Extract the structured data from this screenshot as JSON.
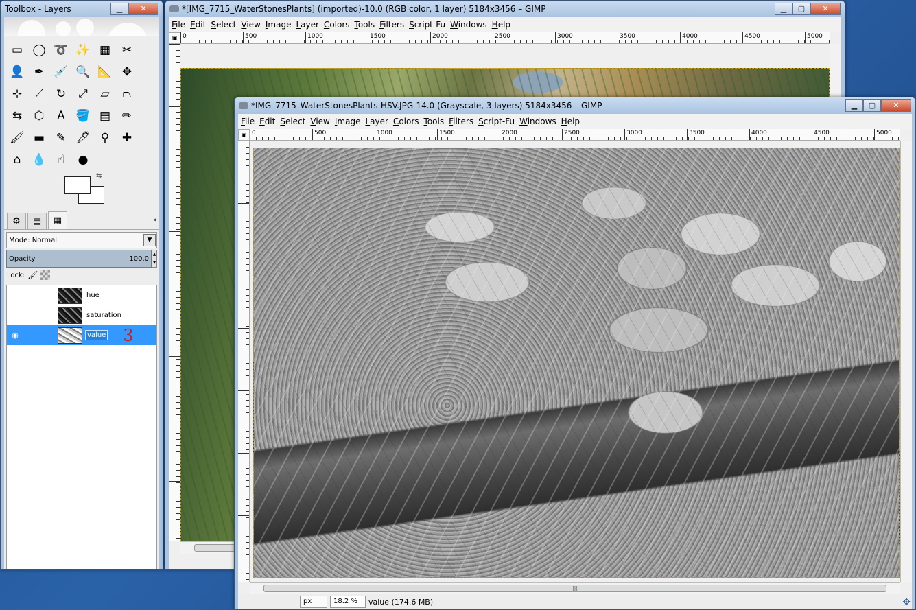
{
  "toolbox": {
    "title": "Toolbox - Layers",
    "controls": {
      "minimize": "▁",
      "close": "✕"
    },
    "tools": [
      {
        "name": "rect-select-icon",
        "glyph": "▭"
      },
      {
        "name": "ellipse-select-icon",
        "glyph": "◯"
      },
      {
        "name": "free-select-icon",
        "glyph": "➰"
      },
      {
        "name": "fuzzy-select-icon",
        "glyph": "✨"
      },
      {
        "name": "select-by-color-icon",
        "glyph": "▦"
      },
      {
        "name": "scissors-select-icon",
        "glyph": "✂"
      },
      {
        "name": "foreground-select-icon",
        "glyph": "👤"
      },
      {
        "name": "paths-icon",
        "glyph": "✒"
      },
      {
        "name": "color-picker-icon",
        "glyph": "💉"
      },
      {
        "name": "zoom-icon",
        "glyph": "🔍"
      },
      {
        "name": "measure-icon",
        "glyph": "📐"
      },
      {
        "name": "move-icon",
        "glyph": "✥"
      },
      {
        "name": "align-icon",
        "glyph": "⊹"
      },
      {
        "name": "crop-icon",
        "glyph": "⟋"
      },
      {
        "name": "rotate-icon",
        "glyph": "↻"
      },
      {
        "name": "scale-icon",
        "glyph": "⤢"
      },
      {
        "name": "shear-icon",
        "glyph": "▱"
      },
      {
        "name": "perspective-icon",
        "glyph": "⏢"
      },
      {
        "name": "flip-icon",
        "glyph": "⇆"
      },
      {
        "name": "cage-transform-icon",
        "glyph": "⬡"
      },
      {
        "name": "text-icon",
        "glyph": "A"
      },
      {
        "name": "bucket-fill-icon",
        "glyph": "🪣"
      },
      {
        "name": "blend-icon",
        "glyph": "▤"
      },
      {
        "name": "pencil-icon",
        "glyph": "✏"
      },
      {
        "name": "paintbrush-icon",
        "glyph": "🖌"
      },
      {
        "name": "eraser-icon",
        "glyph": "▬"
      },
      {
        "name": "airbrush-icon",
        "glyph": "✎"
      },
      {
        "name": "ink-icon",
        "glyph": "🖋"
      },
      {
        "name": "clone-icon",
        "glyph": "⚲"
      },
      {
        "name": "heal-icon",
        "glyph": "✚"
      },
      {
        "name": "perspective-clone-icon",
        "glyph": "⌂"
      },
      {
        "name": "blur-icon",
        "glyph": "💧"
      },
      {
        "name": "smudge-icon",
        "glyph": "☝"
      },
      {
        "name": "dodge-burn-icon",
        "glyph": "●"
      }
    ],
    "tabs": [
      {
        "name": "tab-tool-options",
        "glyph": "⚙"
      },
      {
        "name": "tab-device-status",
        "glyph": "▤"
      },
      {
        "name": "tab-layers",
        "glyph": "▦"
      }
    ],
    "mode_label": "Mode: Normal",
    "opacity_label": "Opacity",
    "opacity_value": "100.0",
    "lock_label": "Lock:",
    "layers": [
      {
        "name": "hue",
        "visible": false,
        "selected": false
      },
      {
        "name": "saturation",
        "visible": false,
        "selected": false
      },
      {
        "name": "value",
        "visible": true,
        "selected": true
      }
    ],
    "layer_count_annotation": "3",
    "layer_buttons": [
      {
        "name": "new-layer-icon",
        "glyph": "🗋"
      },
      {
        "name": "new-layer-group-icon",
        "glyph": "📁"
      },
      {
        "name": "raise-layer-icon",
        "glyph": "⇧"
      },
      {
        "name": "lower-layer-icon",
        "glyph": "⇩"
      },
      {
        "name": "duplicate-layer-icon",
        "glyph": "❐"
      },
      {
        "name": "anchor-layer-icon",
        "glyph": "⚓"
      },
      {
        "name": "delete-layer-icon",
        "glyph": "🗑"
      }
    ]
  },
  "window1": {
    "title": "*[IMG_7715_WaterStonesPlants] (imported)-10.0 (RGB color, 1 layer) 5184x3456 – GIMP",
    "controls": {
      "minimize": "▁",
      "maximize": "▢",
      "close": "✕"
    },
    "ruler_ticks": [
      "0",
      "500",
      "1000",
      "1500",
      "2000",
      "2500",
      "3000",
      "3500",
      "4000",
      "4500",
      "5000"
    ]
  },
  "window2": {
    "title": "*IMG_7715_WaterStonesPlants-HSV.JPG-14.0 (Grayscale, 3 layers) 5184x3456 – GIMP",
    "controls": {
      "minimize": "▁",
      "maximize": "▢",
      "close": "✕"
    },
    "ruler_ticks": [
      "0",
      "500",
      "1000",
      "1500",
      "2000",
      "2500",
      "3000",
      "3500",
      "4000",
      "4500",
      "5000"
    ],
    "unit": "px",
    "zoom": "18.2 %",
    "status": "value (174.6 MB)"
  },
  "menu": [
    "File",
    "Edit",
    "Select",
    "View",
    "Image",
    "Layer",
    "Colors",
    "Tools",
    "Filters",
    "Script-Fu",
    "Windows",
    "Help"
  ]
}
